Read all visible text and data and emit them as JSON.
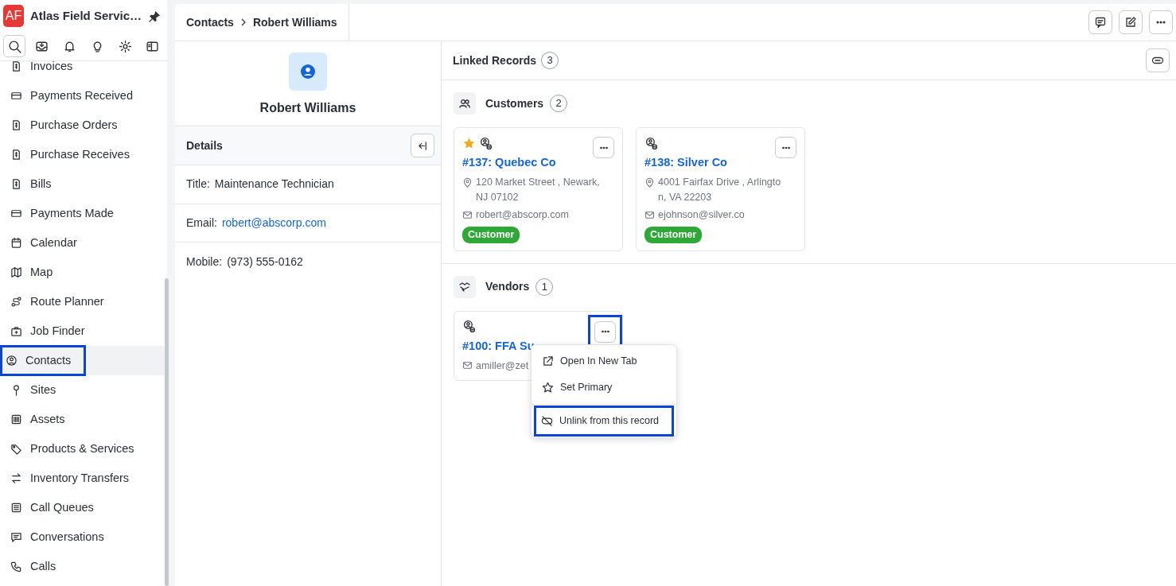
{
  "app": {
    "logo": "AF",
    "title": "Atlas Field Servic…"
  },
  "sidebar": {
    "items": [
      {
        "label": "Invoices",
        "selected": false,
        "highlighted": false
      },
      {
        "label": "Payments Received",
        "selected": false,
        "highlighted": false
      },
      {
        "label": "Purchase Orders",
        "selected": false,
        "highlighted": false
      },
      {
        "label": "Purchase Receives",
        "selected": false,
        "highlighted": false
      },
      {
        "label": "Bills",
        "selected": false,
        "highlighted": false
      },
      {
        "label": "Payments Made",
        "selected": false,
        "highlighted": false
      },
      {
        "label": "Calendar",
        "selected": false,
        "highlighted": false
      },
      {
        "label": "Map",
        "selected": false,
        "highlighted": false
      },
      {
        "label": "Route Planner",
        "selected": false,
        "highlighted": false
      },
      {
        "label": "Job Finder",
        "selected": false,
        "highlighted": false
      },
      {
        "label": "Contacts",
        "selected": true,
        "highlighted": true
      },
      {
        "label": "Sites",
        "selected": false,
        "highlighted": false
      },
      {
        "label": "Assets",
        "selected": false,
        "highlighted": false
      },
      {
        "label": "Products & Services",
        "selected": false,
        "highlighted": false
      },
      {
        "label": "Inventory Transfers",
        "selected": false,
        "highlighted": false
      },
      {
        "label": "Call Queues",
        "selected": false,
        "highlighted": false
      },
      {
        "label": "Conversations",
        "selected": false,
        "highlighted": false
      },
      {
        "label": "Calls",
        "selected": false,
        "highlighted": false
      }
    ]
  },
  "breadcrumb": [
    "Contacts",
    "Robert Williams"
  ],
  "contact": {
    "name": "Robert Williams",
    "details_title": "Details",
    "fields": [
      {
        "label": "Title:",
        "value": "Maintenance Technician",
        "kind": "text"
      },
      {
        "label": "Email:",
        "value": "robert@abscorp.com",
        "kind": "link"
      },
      {
        "label": "Mobile:",
        "value": "(973) 555-0162",
        "kind": "text"
      }
    ]
  },
  "linked": {
    "title": "Linked Records",
    "count": "3",
    "groups": [
      {
        "title": "Customers",
        "count": "2",
        "records": [
          {
            "starred": true,
            "name": "#137: Quebec Co",
            "address": "120 Market Street , Newark, NJ 07102",
            "email": "robert@abscorp.com",
            "tag": "Customer",
            "highlighted": false
          },
          {
            "starred": false,
            "name": "#138: Silver Co",
            "address": "4001 Fairfax Drive , Arlington, VA 22203",
            "email": "ejohnson@silver.co",
            "tag": "Customer",
            "highlighted": false
          }
        ]
      },
      {
        "title": "Vendors",
        "count": "1",
        "records": [
          {
            "starred": false,
            "name": "#100: FFA Su",
            "email": "amiller@zet",
            "highlighted": true,
            "menu": [
              {
                "label": "Open In New Tab",
                "separated": false,
                "highlighted": false
              },
              {
                "label": "Set Primary",
                "separated": false,
                "highlighted": false
              },
              {
                "label": "Unlink from this record",
                "separated": true,
                "highlighted": true
              }
            ]
          }
        ]
      }
    ]
  }
}
